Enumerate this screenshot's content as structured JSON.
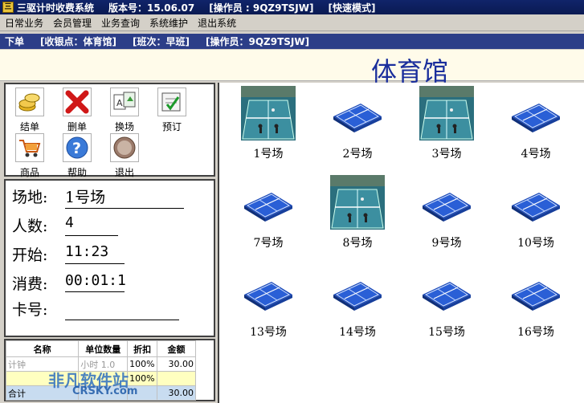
{
  "titlebar": {
    "icon_text": "三",
    "app": "三驱计时收费系统",
    "version": "版本号：15.06.07",
    "operator": "[操作员 : 9QZ9TSJW]",
    "mode": "[快速模式]"
  },
  "menu": [
    "日常业务",
    "会员管理",
    "业务查询",
    "系统维护",
    "退出系统"
  ],
  "status": {
    "order": "下单",
    "point": "[收银点：体育馆]",
    "shift": "[班次：早班]",
    "operator": "[操作员：9QZ9TSJW]"
  },
  "venue_name": "体育馆",
  "tools": [
    {
      "label": "结单",
      "icon": "coins-icon"
    },
    {
      "label": "删单",
      "icon": "delete-x-icon"
    },
    {
      "label": "换场",
      "icon": "swap-icon"
    },
    {
      "label": "预订",
      "icon": "booking-icon"
    },
    {
      "label": "商品",
      "icon": "cart-icon"
    },
    {
      "label": "帮助",
      "icon": "help-icon"
    },
    {
      "label": "退出",
      "icon": "exit-icon"
    }
  ],
  "info": {
    "venue_label": "场地:",
    "venue_value": "1号场",
    "people_label": "人数:",
    "people_value": "4",
    "start_label": "开始:",
    "start_value": "11:23",
    "cost_label": "消费:",
    "cost_value": "00:01:1",
    "card_label": "卡号:",
    "card_value": ""
  },
  "bill": {
    "headers": [
      "名称",
      "单位数量",
      "折扣",
      "金额"
    ],
    "rows": [
      [
        "计钟",
        "小时 1.0",
        "100%",
        "30.00"
      ],
      [
        "",
        "",
        "100%",
        ""
      ],
      [
        "合计",
        "",
        "",
        "30.00"
      ]
    ]
  },
  "courts": [
    {
      "label": "1号场",
      "type": "photo"
    },
    {
      "label": "2号场",
      "type": "icon"
    },
    {
      "label": "3号场",
      "type": "photo"
    },
    {
      "label": "4号场",
      "type": "icon"
    },
    {
      "label": "7号场",
      "type": "icon"
    },
    {
      "label": "8号场",
      "type": "photo"
    },
    {
      "label": "9号场",
      "type": "icon"
    },
    {
      "label": "10号场",
      "type": "icon"
    },
    {
      "label": "13号场",
      "type": "icon"
    },
    {
      "label": "14号场",
      "type": "icon"
    },
    {
      "label": "15号场",
      "type": "icon"
    },
    {
      "label": "16号场",
      "type": "icon"
    }
  ],
  "watermark": {
    "line1": "非凡软件站",
    "line2": "CRSKY.com"
  },
  "colors": {
    "title_bg": "#10246a",
    "status_bg": "#2c3e88",
    "venue_text": "#1a2e9c",
    "court_blue": "#2a5fd6"
  }
}
